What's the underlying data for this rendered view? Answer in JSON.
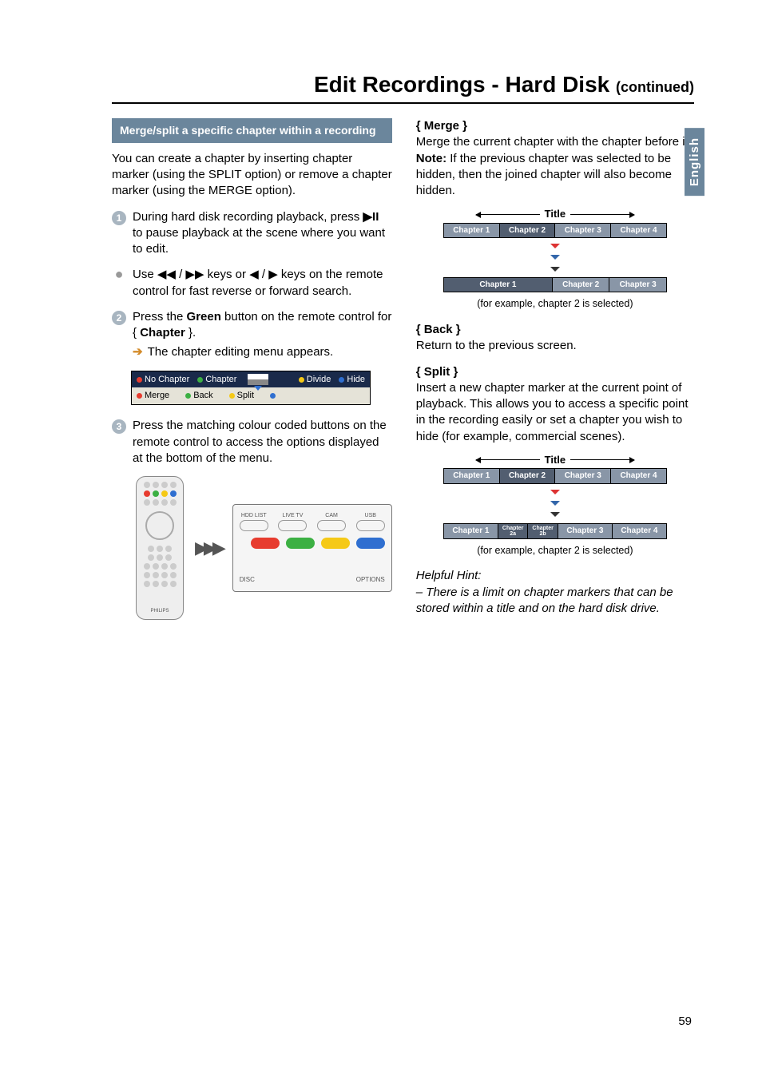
{
  "title_main": "Edit Recordings - Hard Disk",
  "title_cont": "(continued)",
  "side_tab": "English",
  "page_number": "59",
  "left": {
    "subheader": "Merge/split a specific chapter within a recording",
    "intro": "You can create a chapter by inserting chapter marker (using the SPLIT option) or remove a chapter marker (using the MERGE option).",
    "step1_a": "During hard disk recording playback, press ",
    "step1_glyph": "▶II",
    "step1_b": " to pause playback at the scene where you want to edit.",
    "bullet_a": "Use ",
    "bullet_g1": "◀◀ / ▶▶",
    "bullet_mid": " keys or ",
    "bullet_g2": "◀ / ▶",
    "bullet_b": " keys on the remote control for fast reverse or forward search.",
    "step2_a": "Press the ",
    "step2_bold": "Green",
    "step2_b": " button on the remote control for { ",
    "step2_bold2": "Chapter",
    "step2_c": " }.",
    "step2_sub": "The chapter editing menu appears.",
    "osd": {
      "no_chapter": "No Chapter",
      "chapter": "Chapter",
      "divide": "Divide",
      "hide": "Hide",
      "merge": "Merge",
      "back": "Back",
      "split": "Split"
    },
    "step3": "Press the matching colour coded buttons on the remote control to access the options displayed at the bottom of the menu.",
    "device": {
      "hdd": "HDD LIST",
      "live": "LIVE TV",
      "cam": "CAM",
      "usb": "USB",
      "disc": "DISC",
      "options": "OPTIONS"
    },
    "remote_logo": "PHILIPS"
  },
  "right": {
    "merge_head": "Merge",
    "merge_body": "Merge the current chapter with the chapter before it.",
    "note_label": "Note:",
    "note_body": " If the previous chapter was selected to be hidden, then the joined chapter will also become hidden.",
    "diagram1": {
      "title": "Title",
      "before": [
        "Chapter 1",
        "Chapter 2",
        "Chapter 3",
        "Chapter 4"
      ],
      "after_wide": "Chapter 1",
      "after": [
        "Chapter 2",
        "Chapter 3"
      ],
      "caption": "(for example, chapter 2 is selected)"
    },
    "back_head": "Back",
    "back_body": "Return to the previous screen.",
    "split_head": "Split",
    "split_body": "Insert a new chapter marker at the current point of playback. This allows you to access a specific point in the recording easily or set a chapter you wish to hide (for example, commercial scenes).",
    "diagram2": {
      "title": "Title",
      "before": [
        "Chapter 1",
        "Chapter 2",
        "Chapter 3",
        "Chapter 4"
      ],
      "after": [
        "Chapter 1",
        "Chapter 2a",
        "Chapter 2b",
        "Chapter 3",
        "Chapter 4"
      ],
      "caption": "(for example, chapter 2 is selected)"
    },
    "hint_head": "Helpful Hint:",
    "hint_body": "– There is a limit on chapter markers that can be stored within a title and on the hard disk drive."
  }
}
